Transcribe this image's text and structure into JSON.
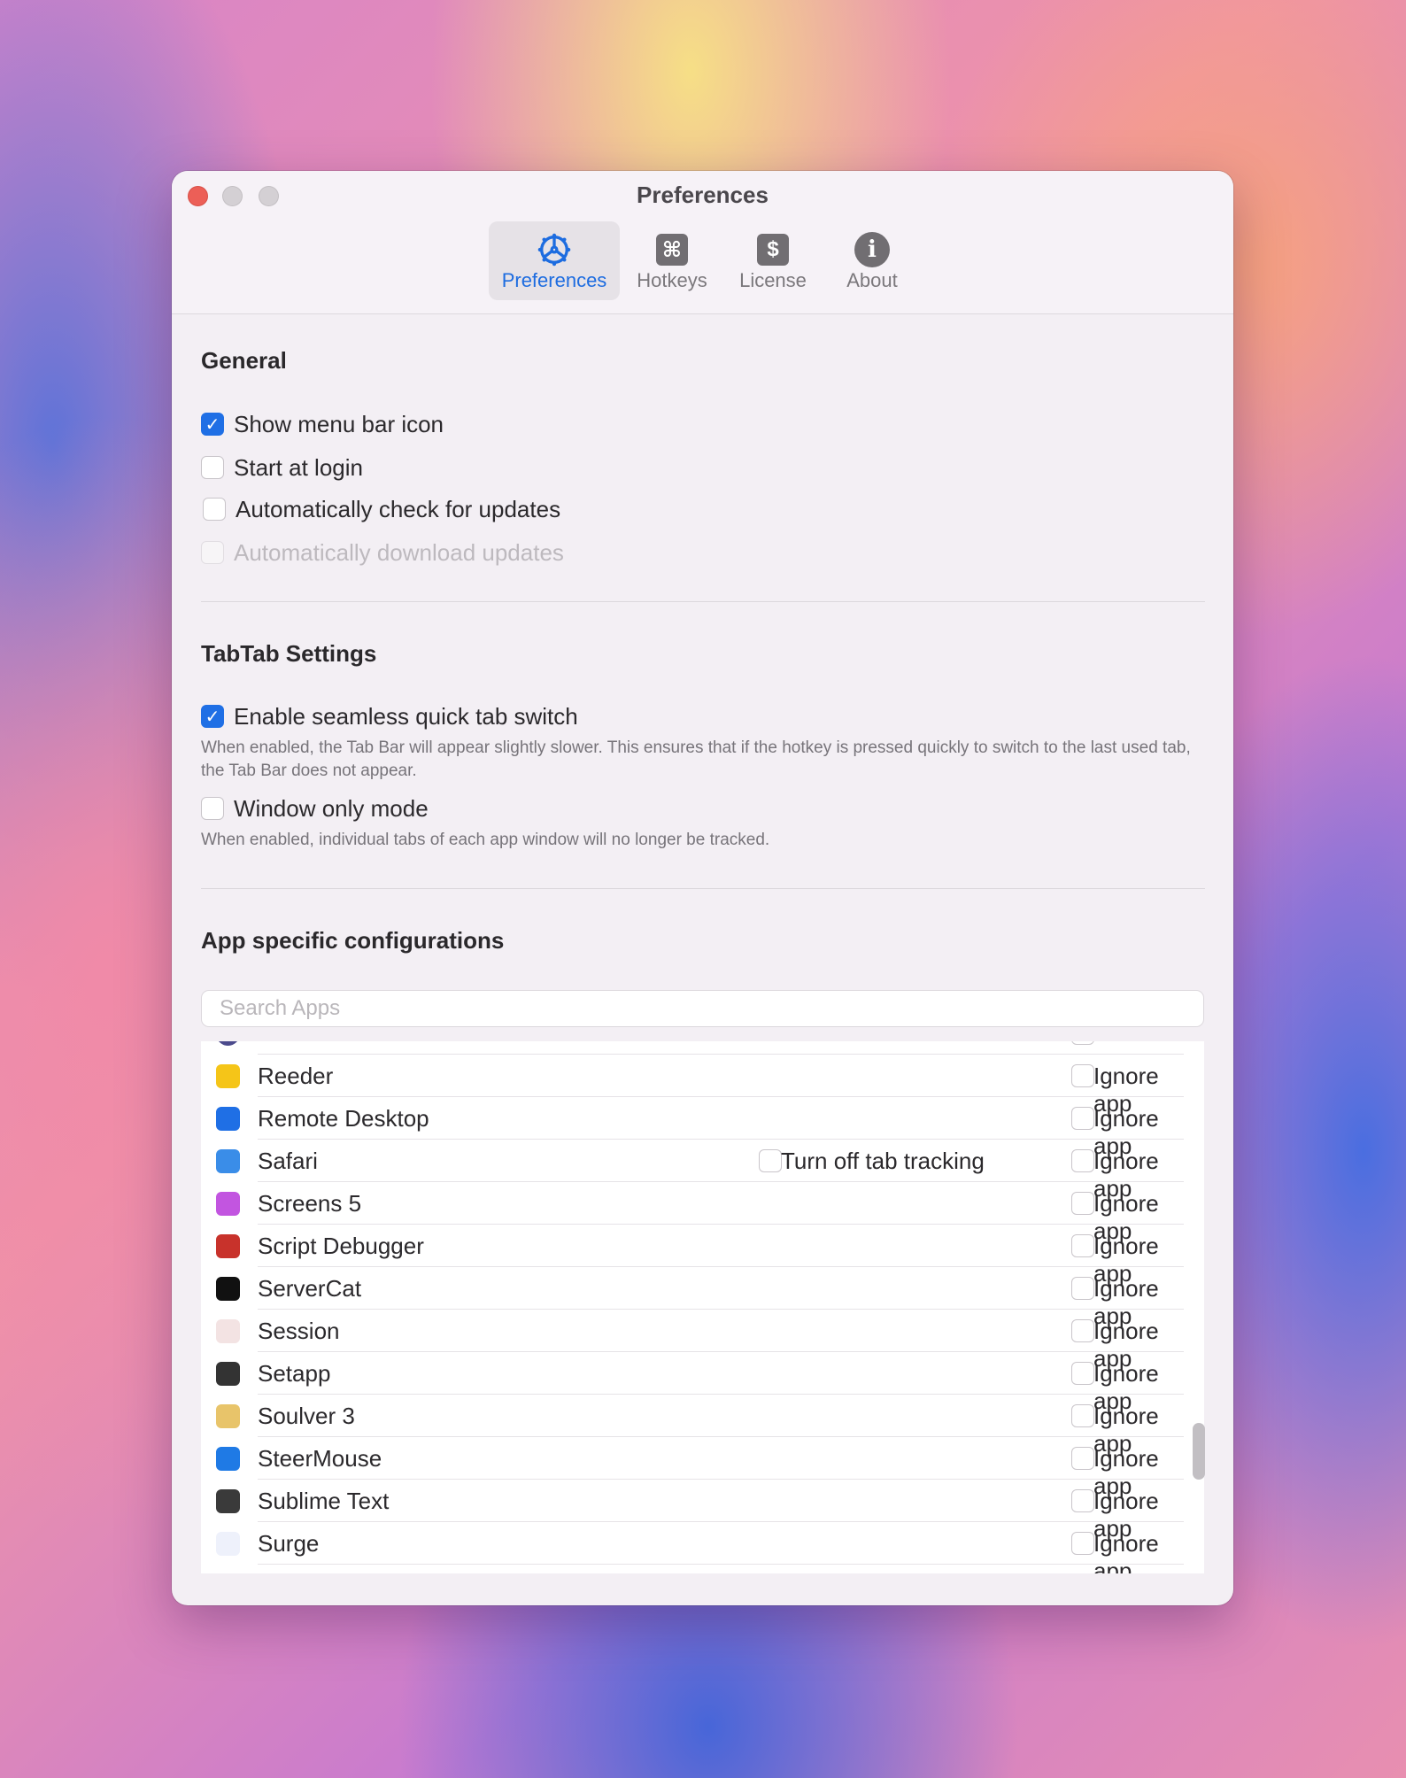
{
  "window": {
    "title": "Preferences"
  },
  "tabs": [
    {
      "label": "Preferences",
      "icon": "gear-icon",
      "selected": true
    },
    {
      "label": "Hotkeys",
      "icon": "command-icon",
      "glyph": "⌘"
    },
    {
      "label": "License",
      "icon": "dollar-icon",
      "glyph": "$"
    },
    {
      "label": "About",
      "icon": "info-icon",
      "glyph": "i"
    }
  ],
  "general": {
    "heading": "General",
    "options": [
      {
        "label": "Show menu bar icon",
        "checked": true
      },
      {
        "label": "Start at login",
        "checked": false
      },
      {
        "label": "Automatically check for updates",
        "checked": false
      },
      {
        "label": "Automatically download updates",
        "checked": false,
        "disabled": true
      }
    ]
  },
  "tabtab": {
    "heading": "TabTab Settings",
    "seamless": {
      "label": "Enable seamless quick tab switch",
      "checked": true,
      "description": "When enabled, the Tab Bar will appear slightly slower. This ensures that if the hotkey is pressed quickly to switch to the last used tab, the Tab Bar does not appear."
    },
    "window_only": {
      "label": "Window only mode",
      "checked": false,
      "description": "When enabled, individual tabs of each app window will no longer be tracked."
    }
  },
  "apps": {
    "heading": "App specific configurations",
    "search_placeholder": "Search Apps",
    "ignore_label": "Ignore app",
    "tab_tracking_label": "Turn off tab tracking",
    "items": [
      {
        "name": "Reeder",
        "color": "#f5c518"
      },
      {
        "name": "Remote Desktop",
        "color": "#1f6fe5"
      },
      {
        "name": "Safari",
        "color": "#3a8de8",
        "tab_tracking": true
      },
      {
        "name": "Screens 5",
        "color": "#c255e0"
      },
      {
        "name": "Script Debugger",
        "color": "#c8322b"
      },
      {
        "name": "ServerCat",
        "color": "#111111"
      },
      {
        "name": "Session",
        "color": "#f3e3e3"
      },
      {
        "name": "Setapp",
        "color": "#333333"
      },
      {
        "name": "Soulver 3",
        "color": "#e8c46a"
      },
      {
        "name": "SteerMouse",
        "color": "#1f7ae5"
      },
      {
        "name": "Sublime Text",
        "color": "#3a3a3a"
      },
      {
        "name": "Surge",
        "color": "#eef1fb"
      }
    ]
  }
}
